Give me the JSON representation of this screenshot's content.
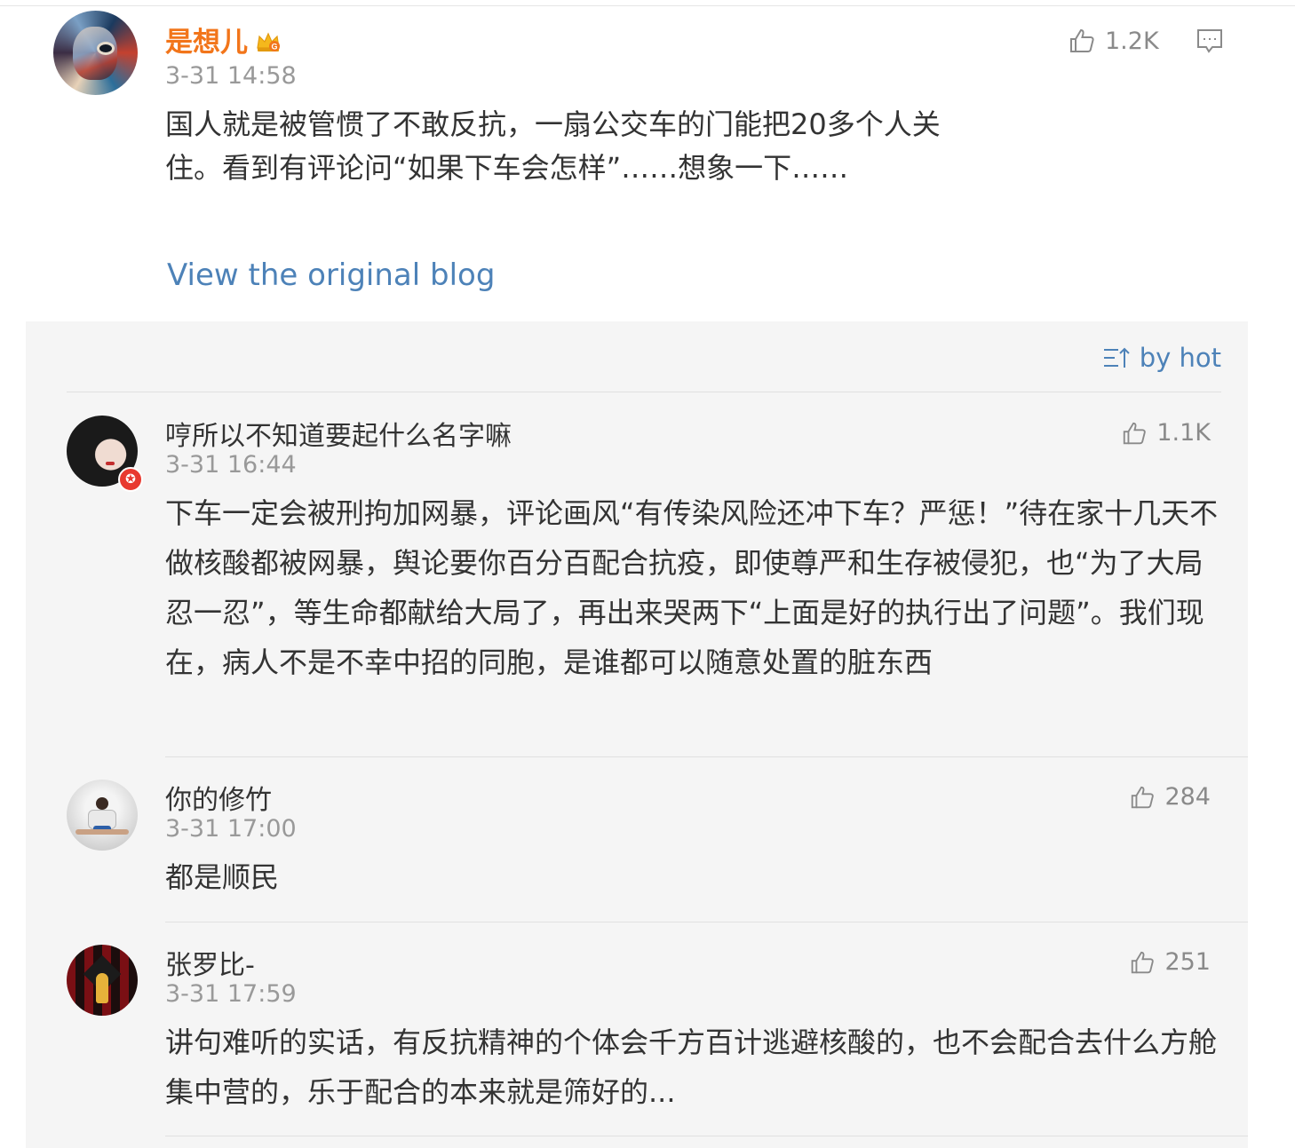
{
  "post": {
    "author": "是想儿",
    "author_badge_icon": "crown-icon",
    "time": "3-31 14:58",
    "likes": "1.2K",
    "text": "国人就是被管惯了不敢反抗，一扇公交车的门能把20多个人关住。看到有评论问“如果下车会怎样”……想象一下……",
    "view_original": "View the original blog"
  },
  "comments_panel": {
    "sort_label": "by hot",
    "comments": [
      {
        "name": "哼所以不知道要起什么名字嘛",
        "time": "3-31 16:44",
        "likes": "1.1K",
        "text": "下车一定会被刑拘加网暴，评论画风“有传染风险还冲下车？严惩！”待在家十几天不做核酸都被网暴，舆论要你百分百配合抗疫，即使尊严和生存被侵犯，也“为了大局忍一忍”，等生命都献给大局了，再出来哭两下“上面是好的执行出了问题”。我们现在，病人不是不幸中招的同胞，是谁都可以随意处置的脏东西"
      },
      {
        "name": "你的修竹",
        "time": "3-31 17:00",
        "likes": "284",
        "text": "都是顺民"
      },
      {
        "name": "张罗比-",
        "time": "3-31 17:59",
        "likes": "251",
        "text": "讲句难听的实话，有反抗精神的个体会千方百计逃避核酸的，也不会配合去什么方舱集中营的，乐于配合的本来就是筛好的..."
      }
    ]
  },
  "colors": {
    "author_orange": "#f2751a",
    "link_blue": "#4d82b8",
    "meta_gray": "#999999",
    "panel_bg": "#f5f5f5"
  }
}
